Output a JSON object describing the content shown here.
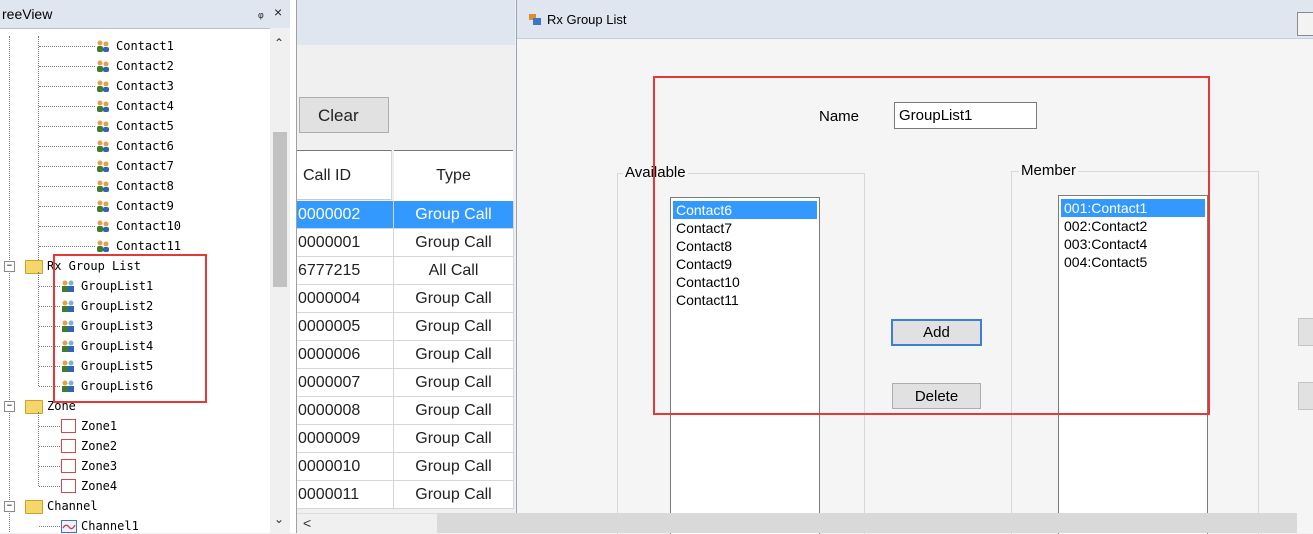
{
  "tree": {
    "title": "reeView",
    "pin_glyph": "ᵩ",
    "close_glyph": "×",
    "contacts": [
      "Contact1",
      "Contact2",
      "Contact3",
      "Contact4",
      "Contact5",
      "Contact6",
      "Contact7",
      "Contact8",
      "Contact9",
      "Contact10",
      "Contact11"
    ],
    "rx_group_list": {
      "label": "Rx Group List",
      "items": [
        "GroupList1",
        "GroupList2",
        "GroupList3",
        "GroupList4",
        "GroupList5",
        "GroupList6"
      ]
    },
    "zone": {
      "label": "Zone",
      "items": [
        "Zone1",
        "Zone2",
        "Zone3",
        "Zone4"
      ]
    },
    "channel": {
      "label": "Channel",
      "items": [
        "Channel1"
      ]
    },
    "icons": {
      "contact": "contacts-icon",
      "group": "group-list-icon",
      "folder": "folder-icon",
      "zone": "zone-icon",
      "channel": "channel-icon"
    }
  },
  "middle": {
    "clear_label": "Clear",
    "columns": [
      "Call ID",
      "Type"
    ],
    "rows": [
      {
        "id": "0000002",
        "type": "Group Call",
        "selected": true
      },
      {
        "id": "0000001",
        "type": "Group Call"
      },
      {
        "id": "6777215",
        "type": "All Call"
      },
      {
        "id": "0000004",
        "type": "Group Call"
      },
      {
        "id": "0000005",
        "type": "Group Call"
      },
      {
        "id": "0000006",
        "type": "Group Call"
      },
      {
        "id": "0000007",
        "type": "Group Call"
      },
      {
        "id": "0000008",
        "type": "Group Call"
      },
      {
        "id": "0000009",
        "type": "Group Call"
      },
      {
        "id": "0000010",
        "type": "Group Call"
      },
      {
        "id": "0000011",
        "type": "Group Call"
      }
    ],
    "scroll_left_glyph": "<"
  },
  "editor": {
    "title": "Rx Group List",
    "name_label": "Name",
    "name_value": "GroupList1",
    "available_label": "Available",
    "member_label": "Member",
    "available": [
      "Contact6",
      "Contact7",
      "Contact8",
      "Contact9",
      "Contact10",
      "Contact11"
    ],
    "members": [
      "001:Contact1",
      "002:Contact2",
      "003:Contact4",
      "004:Contact5"
    ],
    "add_label": "Add",
    "delete_label": "Delete"
  },
  "colors": {
    "selection": "#3399ff",
    "highlight_box": "#e53935",
    "titlebar": "#dfe6ef"
  }
}
